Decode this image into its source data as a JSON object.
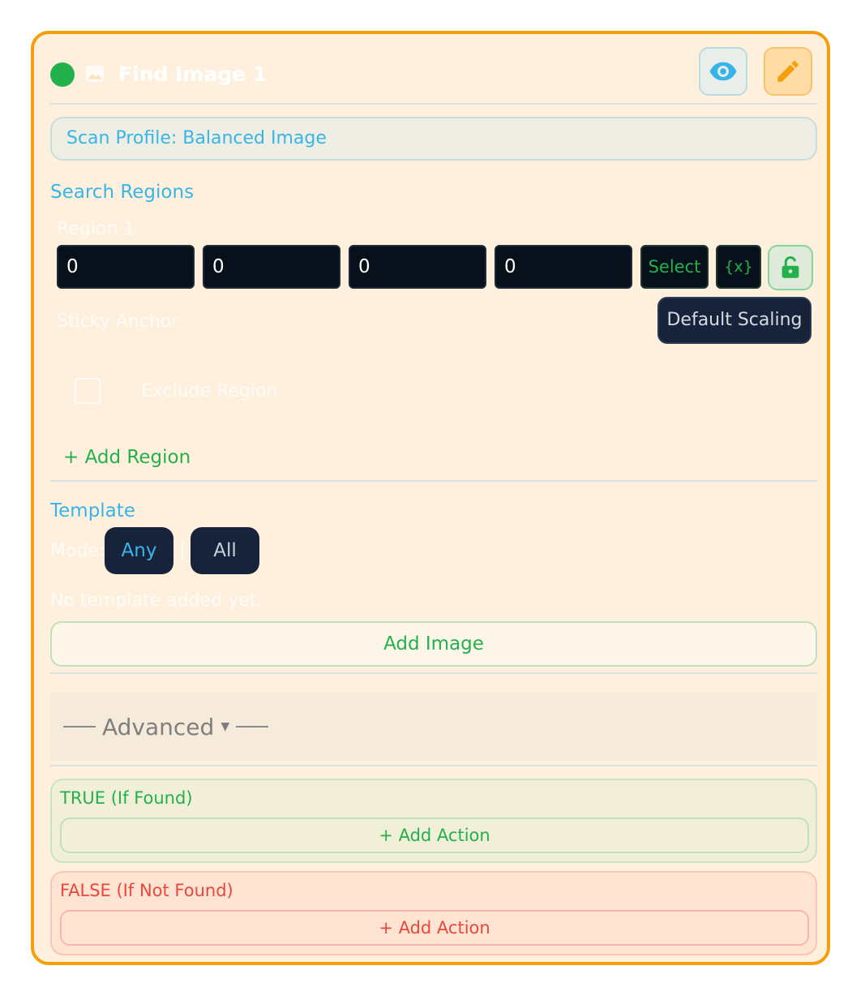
{
  "header": {
    "title": "Find Image 1",
    "status_color": "#22b14c"
  },
  "scan_profile": {
    "label": "Scan Profile: Balanced Image"
  },
  "search_regions": {
    "title": "Search Regions",
    "region_label": "Region 1",
    "coords": [
      "0",
      "0",
      "0",
      "0"
    ],
    "select_label": "Select",
    "variable_label": "{x}",
    "sticky_anchor_label": "Sticky Anchor",
    "scaling_label": "Default Scaling",
    "exclude_region_label": "Exclude Region",
    "add_region_label": "+ Add Region"
  },
  "template": {
    "title": "Template",
    "mode_label": "Mode:",
    "modes": [
      "Any",
      "All"
    ],
    "selected_mode": "Any",
    "empty_text": "No template added yet.",
    "add_image_label": "Add Image"
  },
  "advanced": {
    "label": "Advanced"
  },
  "branches": {
    "true": {
      "label": "TRUE (If Found)",
      "add_action_label": "+ Add Action"
    },
    "false": {
      "label": "FALSE (If Not Found)",
      "add_action_label": "+ Add Action"
    }
  },
  "colors": {
    "accent_orange": "#f59e0b",
    "accent_blue": "#38b5e8",
    "accent_green": "#22b14c",
    "accent_red": "#e9473b"
  },
  "icons": {
    "header_type": "image-icon",
    "preview": "eye-icon",
    "edit": "pencil-icon",
    "lock": "unlocked-lock-icon",
    "advanced": "caret-down-icon"
  }
}
